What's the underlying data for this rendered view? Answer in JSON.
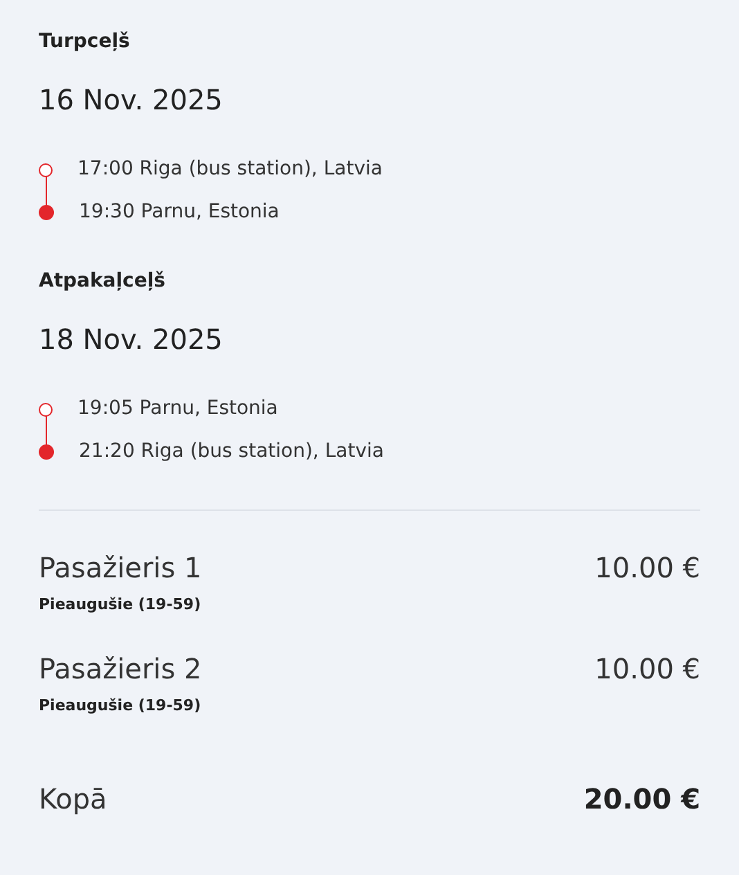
{
  "trips": [
    {
      "heading": "Turpceļš",
      "date": "16 Nov. 2025",
      "stops": [
        {
          "time": "17:00",
          "place": "Riga (bus station), Latvia",
          "kind": "departure"
        },
        {
          "time": "19:30",
          "place": "Parnu, Estonia",
          "kind": "arrival"
        }
      ]
    },
    {
      "heading": "Atpakaļceļš",
      "date": "18 Nov. 2025",
      "stops": [
        {
          "time": "19:05",
          "place": "Parnu, Estonia",
          "kind": "departure"
        },
        {
          "time": "21:20",
          "place": "Riga (bus station), Latvia",
          "kind": "arrival"
        }
      ]
    }
  ],
  "passengers": [
    {
      "name": "Pasažieris 1",
      "category": "Pieaugušie (19-59)",
      "price": "10.00 €"
    },
    {
      "name": "Pasažieris 2",
      "category": "Pieaugušie (19-59)",
      "price": "10.00 €"
    }
  ],
  "total": {
    "label": "Kopā",
    "amount": "20.00 €"
  }
}
